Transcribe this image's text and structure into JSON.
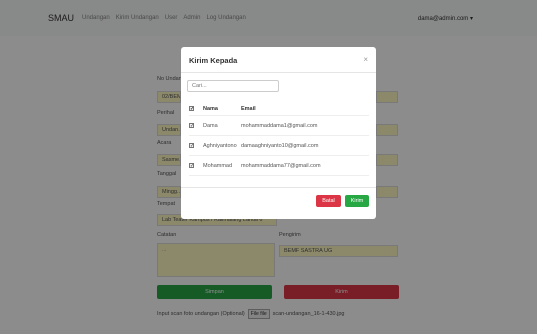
{
  "navbar": {
    "brand": "SMAU",
    "links": [
      "Undangan",
      "Kirim Undangan",
      "User",
      "Admin",
      "Log Undangan"
    ],
    "user": "dama@admin.com"
  },
  "form": {
    "fields": [
      {
        "label": "No Undangan",
        "value": "02/BEM..."
      },
      {
        "label": "Perihal",
        "value": "Undan..."
      },
      {
        "label": "Acara",
        "value": "Sasme..."
      },
      {
        "label": "Tanggal",
        "value": "Mingg..."
      }
    ],
    "tempat_label": "Tempat",
    "tempat_value": "Lab Teater Kampus / Kalimalang Lantai 6",
    "catatan_label": "Catatan",
    "catatan_value": "...",
    "pengirim_label": "Pengirim",
    "pengirim_value": "BEMF SASTRA UG",
    "simpan_label": "Simpan",
    "kirim_label": "Kirim",
    "file_label": "Input scan foto undangan (Optional)",
    "file_button": "File file",
    "file_name": "scan-undangan_16-1-430.jpg"
  },
  "modal": {
    "title": "Kirim Kepada",
    "close": "×",
    "search_placeholder": "Cari...",
    "headers": {
      "name": "Nama",
      "email": "Email"
    },
    "rows": [
      {
        "name": "Dama",
        "email": "mohammaddama1@gmail.com"
      },
      {
        "name": "Aghniyantono",
        "email": "damaaghniyanto10@gmail.com"
      },
      {
        "name": "Mohammad",
        "email": "mohammaddama77@gmail.com"
      }
    ],
    "cancel_label": "Batal",
    "send_label": "Kirim"
  },
  "colors": {
    "green": "#28a745",
    "red": "#dc3545",
    "field_yellow": "#fff9c4"
  }
}
